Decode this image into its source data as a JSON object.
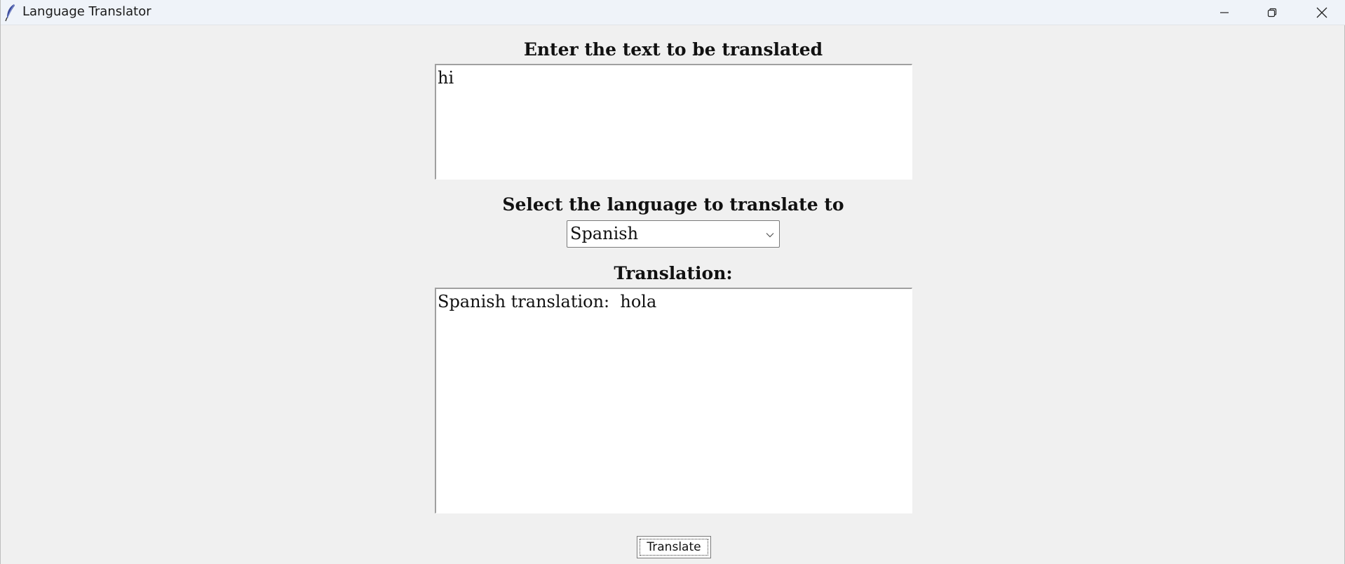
{
  "window": {
    "title": "Language Translator"
  },
  "input_section": {
    "label": "Enter the text to be translated",
    "text": "hi"
  },
  "language_section": {
    "label": "Select the language to translate to",
    "selected": "Spanish"
  },
  "output_section": {
    "label": "Translation:",
    "text": "Spanish translation:  hola"
  },
  "actions": {
    "translate_label": "Translate"
  },
  "icons": {
    "app": "feather-icon",
    "minimize": "minimize-icon",
    "maximize": "restore-icon",
    "close": "close-icon",
    "dropdown": "chevron-down-icon"
  },
  "colors": {
    "window_bg": "#f0f0f0",
    "titlebar_bg": "#eff3f9",
    "text_area_bg": "#ffffff"
  }
}
